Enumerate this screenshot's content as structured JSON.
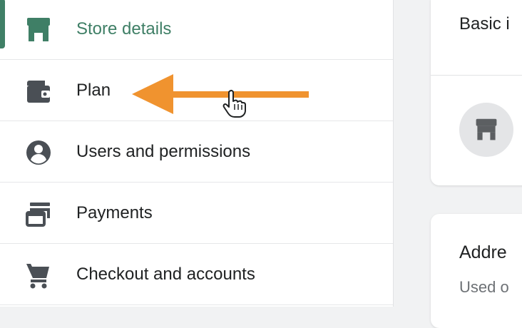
{
  "sidebar": {
    "items": [
      {
        "label": "Store details",
        "icon": "store-icon",
        "active": true
      },
      {
        "label": "Plan",
        "icon": "wallet-icon",
        "active": false
      },
      {
        "label": "Users and permissions",
        "icon": "user-circle-icon",
        "active": false
      },
      {
        "label": "Payments",
        "icon": "payments-icon",
        "active": false
      },
      {
        "label": "Checkout and accounts",
        "icon": "cart-icon",
        "active": false
      }
    ]
  },
  "main": {
    "basic_card": {
      "title": "Basic i",
      "avatar_icon": "store-icon"
    },
    "address_card": {
      "title": "Addre",
      "subtitle": "Used o"
    }
  },
  "annotation": {
    "type": "arrow",
    "color": "#f0932f",
    "direction": "left"
  },
  "colors": {
    "accent": "#3f7f66",
    "text": "#202223",
    "muted": "#6d7175",
    "background": "#f1f2f3"
  }
}
